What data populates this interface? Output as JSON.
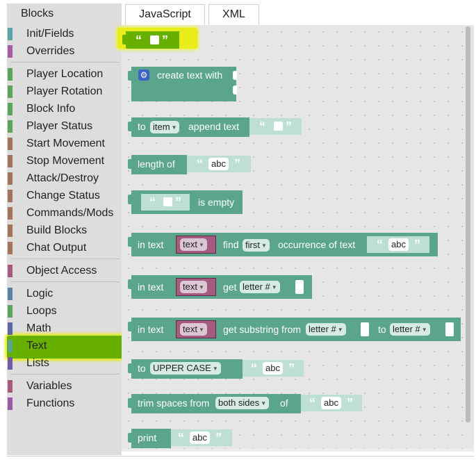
{
  "toolbox": {
    "title": "Blocks",
    "categories": [
      {
        "label": "Init/Fields",
        "color": "#5ba5a5"
      },
      {
        "label": "Overrides",
        "color": "#a55ba5"
      },
      {
        "label": "Player Location",
        "color": "#5ba55b"
      },
      {
        "label": "Player Rotation",
        "color": "#5ba55b"
      },
      {
        "label": "Block Info",
        "color": "#5ba55b"
      },
      {
        "label": "Player Status",
        "color": "#5ba55b"
      },
      {
        "label": "Start Movement",
        "color": "#a5745b"
      },
      {
        "label": "Stop Movement",
        "color": "#a5745b"
      },
      {
        "label": "Attack/Destroy",
        "color": "#a5745b"
      },
      {
        "label": "Change Status",
        "color": "#a5745b"
      },
      {
        "label": "Commands/Mods",
        "color": "#a5745b"
      },
      {
        "label": "Build Blocks",
        "color": "#a5745b"
      },
      {
        "label": "Chat Output",
        "color": "#a5745b"
      },
      {
        "label": "Object Access",
        "color": "#a55b80"
      },
      {
        "label": "Logic",
        "color": "#5b80a5"
      },
      {
        "label": "Loops",
        "color": "#5ba55b"
      },
      {
        "label": "Math",
        "color": "#5b67a5"
      },
      {
        "label": "Text",
        "color": "#5ba58c"
      },
      {
        "label": "Lists",
        "color": "#745ba5"
      },
      {
        "label": "Variables",
        "color": "#a55b80"
      },
      {
        "label": "Functions",
        "color": "#995ba5"
      }
    ]
  },
  "tabs": [
    {
      "label": "JavaScript",
      "active": true
    },
    {
      "label": "XML",
      "active": false
    }
  ],
  "colors": {
    "text_block": "#5ba58c",
    "variable_block": "#a55b80",
    "highlight_yellow": "#e8ec19",
    "highlight_green": "#68b000"
  },
  "blocks": {
    "quote_open": "“",
    "quote_close": "”",
    "create_text": {
      "label": "create text with",
      "icon": "gear-icon"
    },
    "append": {
      "to": "to",
      "var": "item",
      "label": "append text"
    },
    "length": {
      "label": "length of",
      "value": "abc"
    },
    "is_empty": {
      "label": "is empty"
    },
    "indexof": {
      "in_text": "in text",
      "var": "text",
      "find": "find",
      "mode": "first",
      "label": "occurrence of text",
      "value": "abc"
    },
    "charat": {
      "in_text": "in text",
      "var": "text",
      "get": "get",
      "mode": "letter #"
    },
    "substring": {
      "in_text": "in text",
      "var": "text",
      "label": "get substring from",
      "from": "letter #",
      "to": "to",
      "to_mode": "letter #"
    },
    "changecase": {
      "to": "to",
      "mode": "UPPER CASE",
      "value": "abc"
    },
    "trim": {
      "label": "trim spaces from",
      "mode": "both sides",
      "of": "of",
      "value": "abc"
    },
    "print": {
      "label": "print",
      "value": "abc"
    }
  }
}
